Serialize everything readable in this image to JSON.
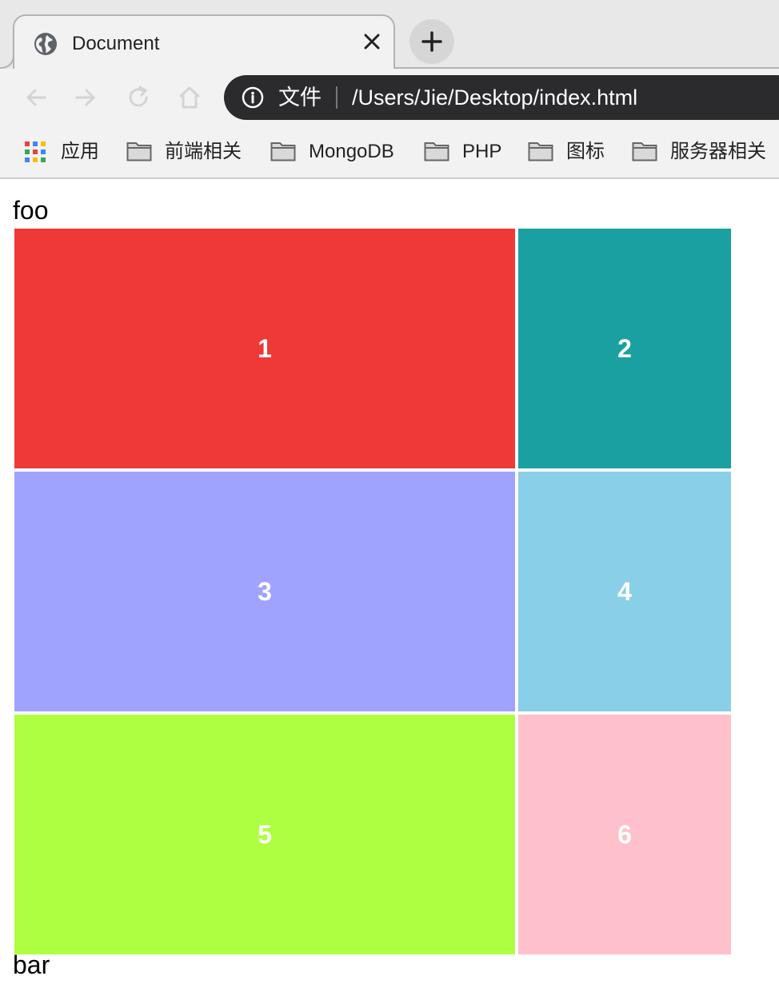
{
  "tab": {
    "title": "Document",
    "favicon": "globe-icon",
    "close_icon": "close-icon"
  },
  "new_tab_icon": "plus-icon",
  "toolbar": {
    "back_icon": "back-arrow-icon",
    "forward_icon": "forward-arrow-icon",
    "reload_icon": "reload-icon",
    "home_icon": "home-icon"
  },
  "address_bar": {
    "info_icon": "info-icon",
    "site_chip": "文件",
    "url": "/Users/Jie/Desktop/index.html"
  },
  "bookmarks": [
    {
      "label": "应用",
      "icon": "apps-grid-icon"
    },
    {
      "label": "前端相关",
      "icon": "folder-icon"
    },
    {
      "label": "MongoDB",
      "icon": "folder-icon"
    },
    {
      "label": "PHP",
      "icon": "folder-icon"
    },
    {
      "label": "图标",
      "icon": "folder-icon"
    },
    {
      "label": "服务器相关",
      "icon": "folder-icon"
    }
  ],
  "page": {
    "top_label": "foo",
    "bottom_label": "bar",
    "cells": [
      {
        "text": "1",
        "color": "#ee3936"
      },
      {
        "text": "2",
        "color": "#1aa0a1"
      },
      {
        "text": "3",
        "color": "#a0a3fd"
      },
      {
        "text": "4",
        "color": "#88cfe7"
      },
      {
        "text": "5",
        "color": "#aefe42"
      },
      {
        "text": "6",
        "color": "#fec1cc"
      }
    ]
  }
}
